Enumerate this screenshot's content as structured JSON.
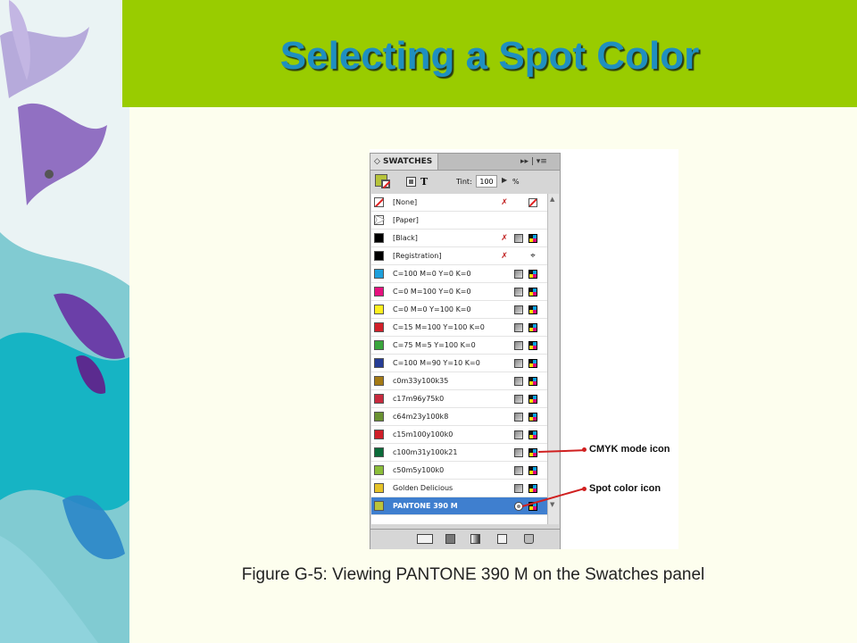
{
  "slide": {
    "title": "Selecting a Spot Color",
    "caption": "Figure G-5: Viewing PANTONE 390 M on the Swatches panel"
  },
  "colors": {
    "header_green": "#99cc00",
    "title_blue": "#1f8fc0",
    "background": "#fdfeee",
    "selection_blue": "#3f7fcf",
    "callout_red": "#d02020"
  },
  "panel": {
    "tab_label": "◇ SWATCHES",
    "tab_controls": "▸▸ | ▾≡",
    "tint_label": "Tint:",
    "tint_value": "100",
    "tint_unit": "%",
    "icons": [
      "fill-stroke-icon",
      "container-icon",
      "text-icon",
      "new-swatch-icon",
      "delete-icon"
    ],
    "swatches": [
      {
        "name": "[None]",
        "color": "none",
        "icons": [
          "noedit",
          "noneslash"
        ]
      },
      {
        "name": "[Paper]",
        "color": "#ffffff",
        "icons": []
      },
      {
        "name": "[Black]",
        "color": "#000000",
        "icons": [
          "noedit",
          "gray",
          "cmyk"
        ]
      },
      {
        "name": "[Registration]",
        "color": "#000000",
        "icons": [
          "noedit",
          "target"
        ]
      },
      {
        "name": "C=100 M=0 Y=0 K=0",
        "color": "#1ea0dc",
        "icons": [
          "gray",
          "cmyk"
        ]
      },
      {
        "name": "C=0 M=100 Y=0 K=0",
        "color": "#e6117f",
        "icons": [
          "gray",
          "cmyk"
        ]
      },
      {
        "name": "C=0 M=0 Y=100 K=0",
        "color": "#fff01e",
        "icons": [
          "gray",
          "cmyk"
        ]
      },
      {
        "name": "C=15 M=100 Y=100 K=0",
        "color": "#d2202a",
        "icons": [
          "gray",
          "cmyk"
        ]
      },
      {
        "name": "C=75 M=5 Y=100 K=0",
        "color": "#3aa63c",
        "icons": [
          "gray",
          "cmyk"
        ]
      },
      {
        "name": "C=100 M=90 Y=10 K=0",
        "color": "#263d96",
        "icons": [
          "gray",
          "cmyk"
        ]
      },
      {
        "name": "c0m33y100k35",
        "color": "#a57a14",
        "icons": [
          "gray",
          "cmyk"
        ]
      },
      {
        "name": "c17m96y75k0",
        "color": "#c82a3e",
        "icons": [
          "gray",
          "cmyk"
        ]
      },
      {
        "name": "c64m23y100k8",
        "color": "#6a9232",
        "icons": [
          "gray",
          "cmyk"
        ]
      },
      {
        "name": "c15m100y100k0",
        "color": "#d01e28",
        "icons": [
          "gray",
          "cmyk"
        ]
      },
      {
        "name": "c100m31y100k21",
        "color": "#0b6b3a",
        "icons": [
          "gray",
          "cmyk"
        ]
      },
      {
        "name": "c50m5y100k0",
        "color": "#8cbe3a",
        "icons": [
          "gray",
          "cmyk"
        ]
      },
      {
        "name": "Golden Delicious",
        "color": "#e6c328",
        "icons": [
          "gray",
          "cmyk"
        ]
      },
      {
        "name": "PANTONE 390 M",
        "color": "#bcc43a",
        "icons": [
          "spot",
          "cmyk"
        ],
        "selected": true
      }
    ]
  },
  "callouts": {
    "cmyk_label": "CMYK mode icon",
    "spot_label": "Spot color icon"
  }
}
